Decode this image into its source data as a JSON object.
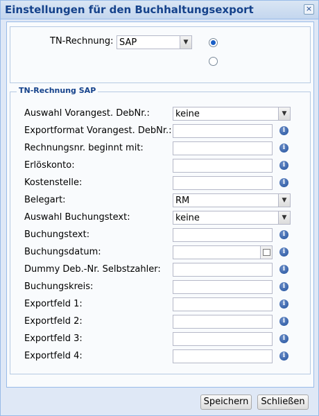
{
  "window": {
    "title": "Einstellungen für den Buchhaltungsexport",
    "close_glyph": "×"
  },
  "top": {
    "tn_label": "TN-Rechnung:",
    "tn_value": "SAP",
    "radio_options": [
      {
        "selected": true
      },
      {
        "selected": false
      }
    ]
  },
  "fieldset": {
    "legend": "TN-Rechnung SAP",
    "fields": [
      {
        "label": "Auswahl Vorangest. DebNr.:",
        "type": "select",
        "value": "keine"
      },
      {
        "label": "Exportformat Vorangest. DebNr.:",
        "type": "text",
        "value": ""
      },
      {
        "label": "Rechnungsnr. beginnt mit:",
        "type": "text",
        "value": ""
      },
      {
        "label": "Erlöskonto:",
        "type": "text",
        "value": ""
      },
      {
        "label": "Kostenstelle:",
        "type": "text",
        "value": ""
      },
      {
        "label": "Belegart:",
        "type": "select",
        "value": "RM"
      },
      {
        "label": "Auswahl Buchungstext:",
        "type": "select",
        "value": "keine"
      },
      {
        "label": "Buchungstext:",
        "type": "text",
        "value": ""
      },
      {
        "label": "Buchungsdatum:",
        "type": "date",
        "value": ""
      },
      {
        "label": "Dummy Deb.-Nr. Selbstzahler:",
        "type": "text",
        "value": ""
      },
      {
        "label": "Buchungskreis:",
        "type": "text",
        "value": ""
      },
      {
        "label": "Exportfeld 1:",
        "type": "text",
        "value": ""
      },
      {
        "label": "Exportfeld 2:",
        "type": "text",
        "value": ""
      },
      {
        "label": "Exportfeld 3:",
        "type": "text",
        "value": ""
      },
      {
        "label": "Exportfeld 4:",
        "type": "text",
        "value": ""
      }
    ]
  },
  "buttons": {
    "save": "Speichern",
    "close": "Schließen"
  },
  "icons": {
    "info": "info-icon",
    "dropdown": "chevron-down-icon",
    "calendar": "calendar-icon",
    "close": "close-icon"
  },
  "colors": {
    "title_text": "#15428b",
    "info_icon": "#1f4f9c",
    "radio_selected": "#1a5fc6"
  }
}
